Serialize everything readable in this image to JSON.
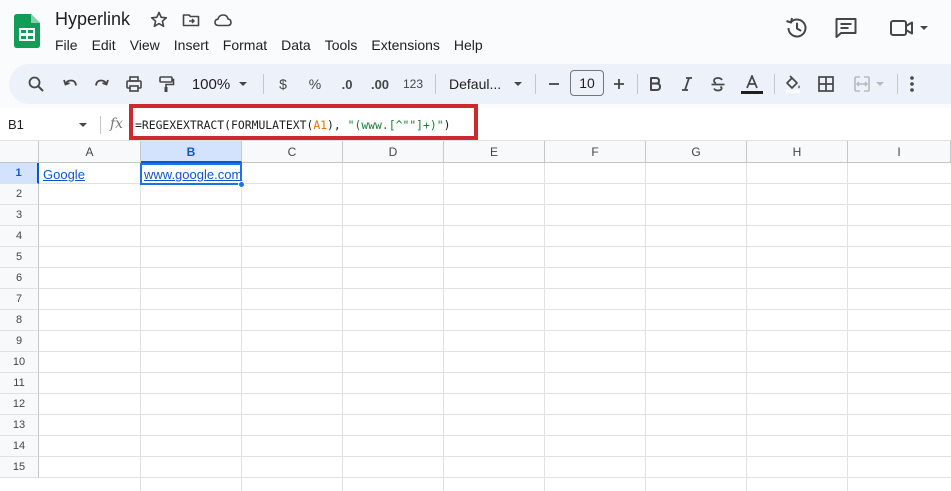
{
  "document": {
    "title": "Hyperlink"
  },
  "menu": [
    "File",
    "Edit",
    "View",
    "Insert",
    "Format",
    "Data",
    "Tools",
    "Extensions",
    "Help"
  ],
  "toolbar": {
    "zoom": "100%",
    "currency": "$",
    "percent": "%",
    "decrease_decimal": ".0",
    "increase_decimal": ".00",
    "number_format": "123",
    "font": "Defaul...",
    "font_size": "10"
  },
  "formula_bar": {
    "name_box": "B1",
    "fx": "fx",
    "formula_prefix": "=REGEXEXTRACT(FORMULATEXT(",
    "formula_ref": "A1",
    "formula_mid": "), ",
    "formula_string": "\"(www.[^\"\"]+)\"",
    "formula_suffix": ")"
  },
  "sheet": {
    "columns": [
      "A",
      "B",
      "C",
      "D",
      "E",
      "F",
      "G",
      "H",
      "I"
    ],
    "rows": [
      "1",
      "2",
      "3",
      "4",
      "5",
      "6",
      "7",
      "8",
      "9",
      "10",
      "11",
      "12",
      "13",
      "14",
      "15"
    ],
    "cells": {
      "A1": "Google",
      "B1": "www.google.com"
    },
    "selected_cell": "B1"
  },
  "colors": {
    "accent": "#1a73e8",
    "highlight": "#cc2a2f",
    "link": "#1155cc",
    "sheets_green": "#0f9d58"
  }
}
